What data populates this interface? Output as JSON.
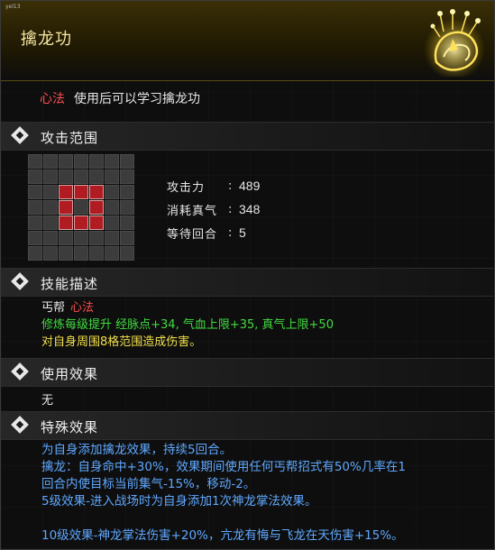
{
  "header": {
    "corner_tag": "yel13",
    "title": "擒龙功"
  },
  "usage": {
    "keyword": "心法",
    "text": "使用后可以学习擒龙功"
  },
  "sections": {
    "attack_range": "攻击范围",
    "skill_desc": "技能描述",
    "use_effect": "使用效果",
    "special_effect": "特殊效果"
  },
  "range_grid": {
    "size": 7,
    "active_cells": [
      [
        2,
        2
      ],
      [
        2,
        3
      ],
      [
        2,
        4
      ],
      [
        3,
        2
      ],
      [
        3,
        4
      ],
      [
        4,
        2
      ],
      [
        4,
        3
      ],
      [
        4,
        4
      ]
    ]
  },
  "stats": [
    {
      "label": "攻击力",
      "value": "489"
    },
    {
      "label": "消耗真气",
      "value": "348"
    },
    {
      "label": "等待回合",
      "value": "5"
    }
  ],
  "description": {
    "school": "丐帮",
    "category": "心法",
    "upgrade": "修炼每级提升 经脉点+34, 气血上限+35, 真气上限+50",
    "damage": "对自身周围8格范围造成伤害。"
  },
  "use_effect_text": "无",
  "special_lines": [
    "为自身添加擒龙效果，持续5回合。",
    "擒龙：自身命中+30%，效果期间使用任何丐帮招式有50%几率在1",
    "回合内使目标当前集气-15%，移动-2。",
    "5级效果-进入战场时为自身添加1次神龙掌法效果。",
    "",
    "10级效果-神龙掌法伤害+20%，亢龙有悔与飞龙在天伤害+15%。"
  ],
  "colors": {
    "title_gold": "#f7e7a0",
    "keyword_red": "#ff4d4d",
    "upgrade_green": "#3fdc3f",
    "damage_yellow": "#f2e04a",
    "special_blue": "#5fa8ff",
    "grid_active": "#b01c22"
  },
  "icons": {
    "emblem": "golden-dragon-emblem-icon",
    "section_marker": "diamond-icon"
  }
}
